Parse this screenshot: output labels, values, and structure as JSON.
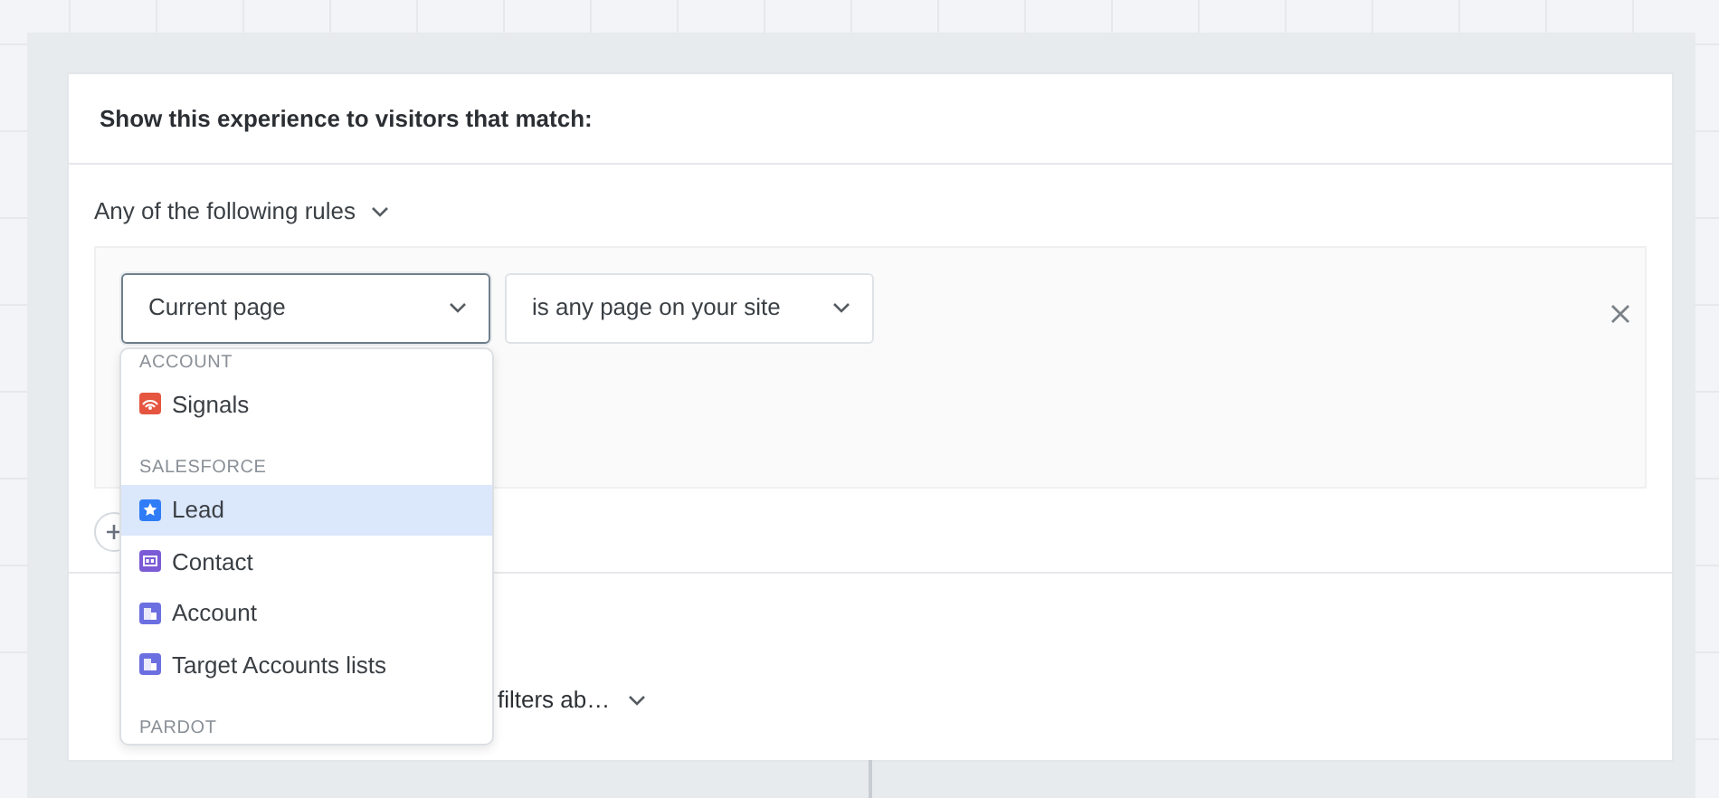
{
  "card": {
    "title": "Show this experience to visitors that match:",
    "match_mode": "Any of the following rules",
    "rules": [
      {
        "field": "Current page",
        "operator": "is any page on your site",
        "focused": true
      }
    ],
    "lower_select": "filters ab…"
  },
  "dropdown": {
    "groups": [
      {
        "heading": "ACCOUNT",
        "items": [
          {
            "label": "Signals",
            "color": "#e5553f",
            "selected": false
          }
        ]
      },
      {
        "heading": "SALESFORCE",
        "items": [
          {
            "label": "Lead",
            "color": "#2f7cf6",
            "selected": true
          },
          {
            "label": "Contact",
            "color": "#7b5bd6",
            "selected": false
          },
          {
            "label": "Account",
            "color": "#6b6fe0",
            "selected": false
          },
          {
            "label": "Target Accounts lists",
            "color": "#6b6fe0",
            "selected": false
          }
        ]
      },
      {
        "heading": "PARDOT"
      }
    ]
  }
}
